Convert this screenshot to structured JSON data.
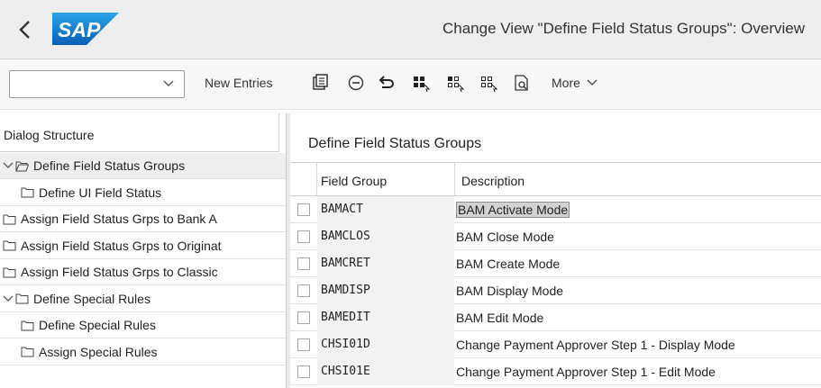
{
  "header": {
    "logo_text": "SAP",
    "title": "Change View \"Define Field Status Groups\": Overview"
  },
  "toolbar": {
    "command_field_value": "",
    "new_entries_label": "New Entries",
    "more_label": "More"
  },
  "dialog_structure": {
    "title": "Dialog Structure",
    "items": [
      {
        "label": "Define Field Status Groups",
        "level": 0,
        "expanded": true,
        "selected": true
      },
      {
        "label": "Define UI Field Status",
        "level": 1,
        "expanded": false,
        "selected": false
      },
      {
        "label": "Assign Field Status Grps to Bank A",
        "level": 0,
        "expanded": false,
        "selected": false
      },
      {
        "label": "Assign Field Status Grps to Originat",
        "level": 0,
        "expanded": false,
        "selected": false
      },
      {
        "label": "Assign Field Status Grps to Classic",
        "level": 0,
        "expanded": false,
        "selected": false
      },
      {
        "label": "Define Special Rules",
        "level": 0,
        "expanded": true,
        "selected": false
      },
      {
        "label": "Define Special Rules",
        "level": 1,
        "expanded": false,
        "selected": false
      },
      {
        "label": "Assign Special Rules",
        "level": 1,
        "expanded": false,
        "selected": false
      }
    ]
  },
  "main": {
    "section_title": "Define Field Status Groups",
    "columns": [
      "Field Group",
      "Description"
    ],
    "rows": [
      {
        "field_group": "BAMACT",
        "description": "BAM Activate Mode",
        "focused": true
      },
      {
        "field_group": "BAMCLOS",
        "description": "BAM Close Mode",
        "focused": false
      },
      {
        "field_group": "BAMCRET",
        "description": "BAM Create Mode",
        "focused": false
      },
      {
        "field_group": "BAMDISP",
        "description": "BAM Display Mode",
        "focused": false
      },
      {
        "field_group": "BAMEDIT",
        "description": "BAM Edit Mode",
        "focused": false
      },
      {
        "field_group": "CHSI01D",
        "description": "Change Payment Approver Step 1 - Display Mode",
        "focused": false
      },
      {
        "field_group": "CHSI01E",
        "description": "Change Payment Approver Step 1 - Edit Mode",
        "focused": false
      }
    ]
  },
  "colors": {
    "brand_blue": "#1170c9",
    "title_bar": "#eeeeee",
    "toolbar": "#f7f7f7",
    "key_column": "#f2f2f2",
    "selected_tree_item": "#efefef"
  },
  "icons": {
    "back": "chevron-left-icon",
    "command_dropdown": "chevron-down-icon",
    "toolbar": [
      "copy-as-icon",
      "delete-icon",
      "undo-icon",
      "select-all-icon",
      "select-block-icon",
      "deselect-all-icon",
      "print-preview-icon"
    ],
    "more_dropdown": "chevron-down-icon",
    "tree_expanded": "chevron-down-icon",
    "tree_folder": "folder-icon",
    "tree_folder_open": "folder-open-icon"
  }
}
